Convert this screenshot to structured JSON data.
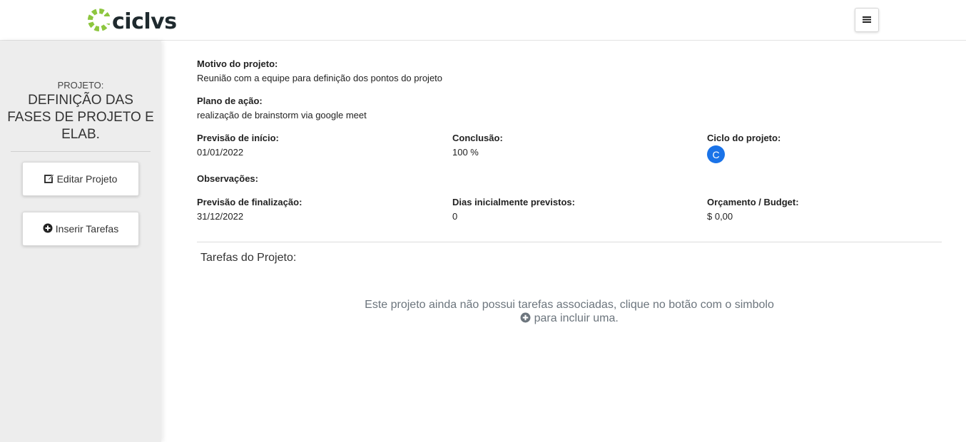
{
  "header": {
    "logo_text": "ciclvs",
    "logo_icon": "ciclvs-logo-icon",
    "menu_icon": "hamburger-icon",
    "brand_green": "#8dc63f",
    "brand_dark": "#1f2a2e"
  },
  "sidebar": {
    "project_label": "PROJETO:",
    "project_name": "DEFINIÇÃO DAS FASES DE PROJETO E ELAB.",
    "edit_button": "Editar Projeto",
    "edit_icon": "edit-icon",
    "insert_button": "Inserir Tarefas",
    "insert_icon": "plus-circle-icon"
  },
  "project": {
    "motivo_label": "Motivo do projeto:",
    "motivo_value": "Reunião com a equipe para definição dos pontos do projeto",
    "plano_label": "Plano de ação:",
    "plano_value": "realização de brainstorm via google meet",
    "inicio_label": "Previsão de início:",
    "inicio_value": "01/01/2022",
    "conclusao_label": "Conclusão:",
    "conclusao_value": "100 %",
    "ciclo_label": "Ciclo do projeto:",
    "ciclo_value": "C",
    "ciclo_color": "#1a73e8",
    "observacoes_label": "Observações:",
    "finalizacao_label": "Previsão de finalização:",
    "finalizacao_value": "31/12/2022",
    "dias_label": "Dias inicialmente previstos:",
    "dias_value": "0",
    "orcamento_label": "Orçamento / Budget:",
    "orcamento_value": "$ 0,00"
  },
  "tasks": {
    "title": "Tarefas do Projeto:",
    "empty_line1": "Este projeto ainda não possui tarefas associadas, clique no botão com o simbolo",
    "empty_line2": "para incluir uma.",
    "empty_icon": "plus-circle-icon"
  }
}
